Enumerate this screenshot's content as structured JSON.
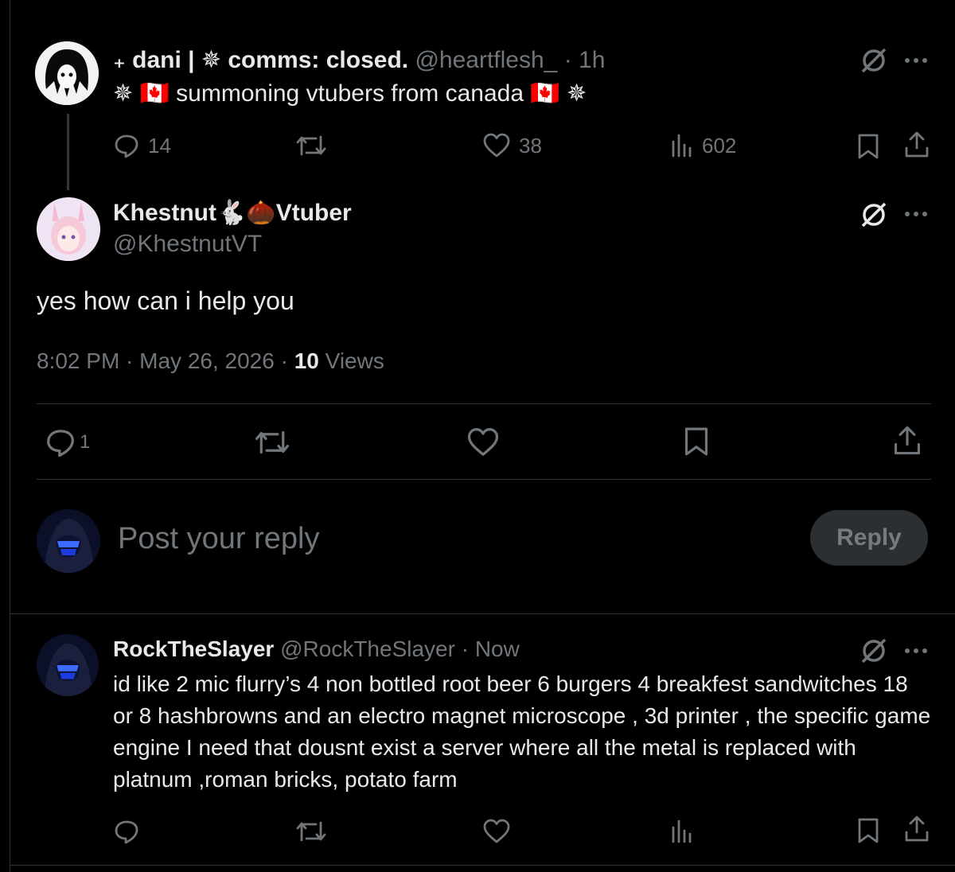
{
  "parent_tweet": {
    "name": "₊ dani | ✵ comms: closed.",
    "handle": "@heartflesh_",
    "time": "· 1h",
    "text": "✵ 🇨🇦 summoning vtubers from canada 🇨🇦 ✵",
    "replies": "14",
    "likes": "38",
    "views": "602",
    "icons": [
      "grok-icon",
      "more-icon",
      "reply-icon",
      "retweet-icon",
      "like-icon",
      "views-icon",
      "bookmark-icon",
      "share-icon"
    ]
  },
  "main_tweet": {
    "name": "Khestnut🐇🌰Vtuber",
    "handle": "@KhestnutVT",
    "text": "yes how can i help you",
    "time": "8:02 PM · May 26, 2026 · ",
    "views_count": "10",
    "views_label": " Views",
    "replies": "1"
  },
  "reply_box": {
    "placeholder": "Post your reply",
    "button_label": "Reply"
  },
  "reply_tweet": {
    "name": "RockTheSlayer",
    "handle": "@RockTheSlayer",
    "time": "· Now",
    "text": "id like 2 mic flurry’s 4 non bottled root beer 6 burgers 4 breakfest sandwitches 18 or 8 hashbrowns and an electro magnet microscope , 3d printer , the specific game engine I need that dousnt exist a server where all the metal is replaced with platnum ,roman bricks, potato farm"
  },
  "colors": {
    "background": "#000000",
    "text": "#e7e9ea",
    "muted": "#71767b",
    "divider": "#2f3336",
    "reply_button_bg": "#2b2f32"
  }
}
